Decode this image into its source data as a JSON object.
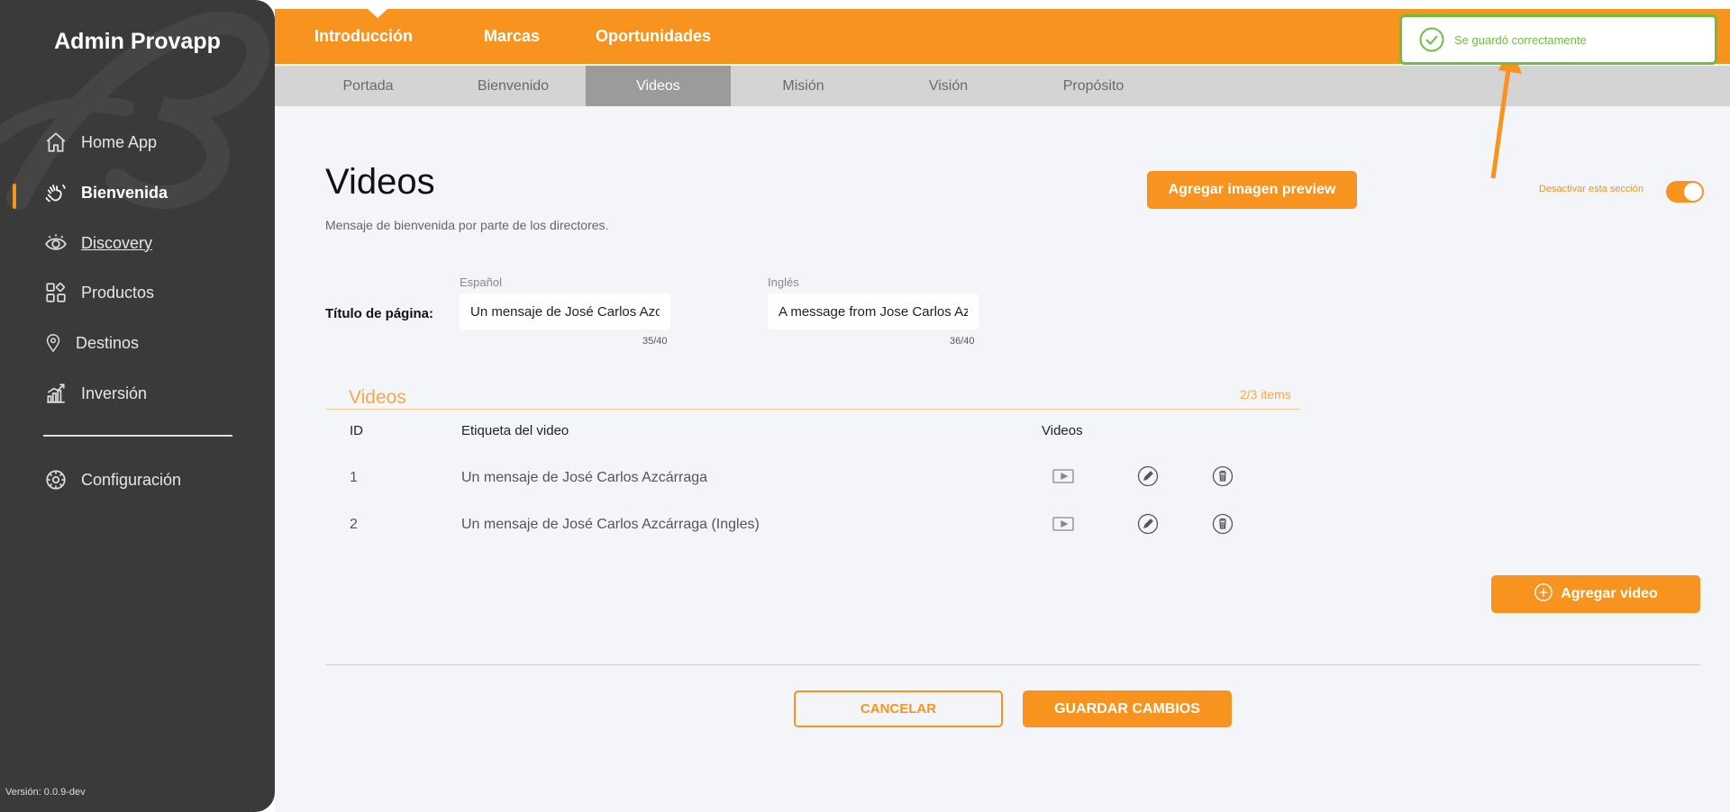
{
  "sidebar": {
    "brand": "Admin Provapp",
    "items": [
      {
        "label": "Home App",
        "icon": "home-icon"
      },
      {
        "label": "Bienvenida",
        "icon": "wave-hand-icon"
      },
      {
        "label": "Discovery",
        "icon": "eye-icon"
      },
      {
        "label": "Productos",
        "icon": "grid-icon"
      },
      {
        "label": "Destinos",
        "icon": "map-pin-icon"
      },
      {
        "label": "Inversión",
        "icon": "chart-icon"
      }
    ],
    "config": {
      "label": "Configuración",
      "icon": "gear-icon"
    },
    "version": "Versión: 0.0.9-dev"
  },
  "topnav": {
    "tabs": [
      "Introducción",
      "Marcas",
      "Oportunidades"
    ],
    "active": "Introducción"
  },
  "subnav": {
    "tabs": [
      "Portada",
      "Bienvenido",
      "Videos",
      "Misión",
      "Visión",
      "Propósito"
    ],
    "active": "Videos"
  },
  "main": {
    "title": "Videos",
    "subtitle": "Mensaje de bienvenida por parte de los directores.",
    "preview_button": "Agregar imagen preview",
    "toggle_label": "Desactivar esta sección",
    "toggle_on": true,
    "page_title_label": "Título de página:",
    "spanish_label": "Español",
    "english_label": "Inglés",
    "spanish_value": "Un mensaje de José Carlos Azcárraga",
    "english_value": "A message from Jose Carlos Azcárraga",
    "spanish_count": "35/40",
    "english_count": "36/40",
    "videos_heading": "Videos",
    "items_count": "2/3 items",
    "table": {
      "headers": [
        "ID",
        "Etiqueta del video",
        "Videos"
      ],
      "rows": [
        {
          "id": "1",
          "label": "Un mensaje de José Carlos Azcárraga"
        },
        {
          "id": "2",
          "label": "Un mensaje de José Carlos Azcárraga (Ingles)"
        }
      ]
    },
    "add_video_button": "Agregar video",
    "cancel_button": "CANCELAR",
    "save_button": "GUARDAR CAMBIOS"
  },
  "toast": {
    "message": "Se guardó correctamente"
  },
  "colors": {
    "accent": "#f7931e",
    "sidebar": "#3a3a3a",
    "success": "#6cbf3c"
  }
}
